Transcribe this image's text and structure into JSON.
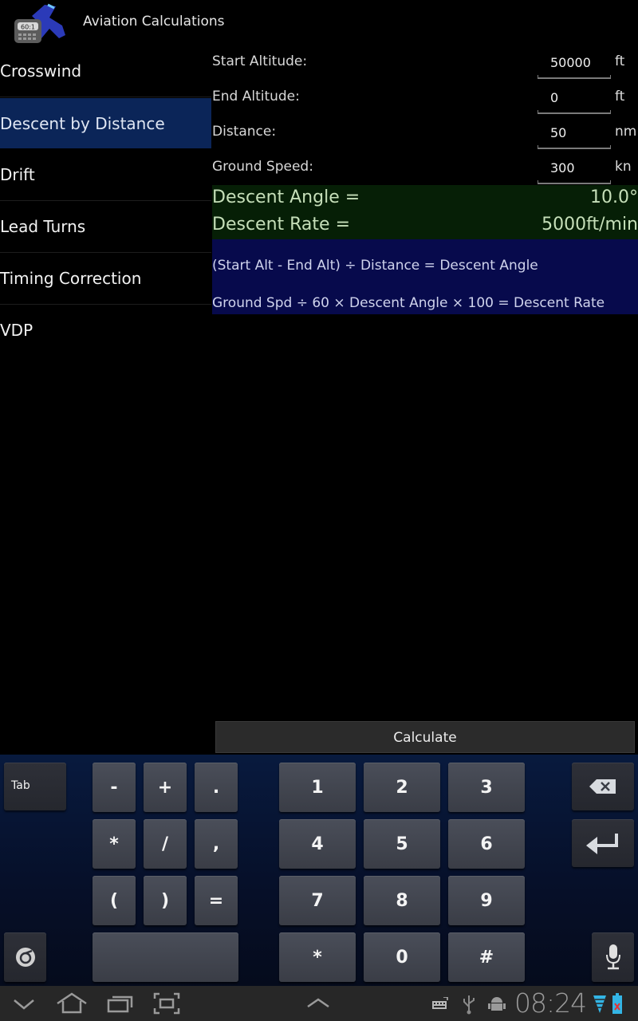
{
  "app": {
    "title": "Aviation Calculations",
    "icon": "app-icon-airplane-calculator",
    "icon_badge": "60:1"
  },
  "sidebar": {
    "items": [
      {
        "label": "Crosswind",
        "selected": false
      },
      {
        "label": "Descent by Distance",
        "selected": true
      },
      {
        "label": "Drift",
        "selected": false
      },
      {
        "label": "Lead Turns",
        "selected": false
      },
      {
        "label": "Timing Correction",
        "selected": false
      },
      {
        "label": "VDP",
        "selected": false
      }
    ]
  },
  "form": {
    "fields": [
      {
        "label": "Start Altitude:",
        "value": "50000",
        "unit": "ft"
      },
      {
        "label": "End Altitude:",
        "value": "0",
        "unit": "ft"
      },
      {
        "label": "Distance:",
        "value": "50",
        "unit": "nm"
      },
      {
        "label": "Ground Speed:",
        "value": "300",
        "unit": "kn"
      }
    ]
  },
  "results": {
    "descent_angle_label": "Descent Angle =",
    "descent_angle_value": "10.0°",
    "descent_rate_label": "Descent Rate =",
    "descent_rate_value": "5000ft/min"
  },
  "formulas": {
    "angle": "(Start Alt - End Alt) ÷ Distance = Descent Angle",
    "rate": "Ground Spd ÷ 60 × Descent Angle × 100 = Descent Rate"
  },
  "calculate_label": "Calculate",
  "keyboard": {
    "tab_label": "Tab",
    "symbols": [
      "-",
      "+",
      ".",
      "*",
      "/",
      ",",
      "(",
      ")",
      "="
    ],
    "digits": [
      "1",
      "2",
      "3",
      "4",
      "5",
      "6",
      "7",
      "8",
      "9",
      "*",
      "0",
      "#"
    ],
    "icons": {
      "backspace": "backspace-icon",
      "enter": "enter-icon",
      "settings": "keyboard-settings-icon",
      "mic": "microphone-icon"
    }
  },
  "navbar": {
    "buttons": [
      "back-icon",
      "home-icon",
      "recent-apps-icon",
      "screenshot-icon",
      "menu-up-icon"
    ],
    "status_icons": [
      "keyboard-icon",
      "usb-icon",
      "android-debug-icon",
      "wifi-icon",
      "battery-icon"
    ],
    "clock": "08:24"
  },
  "colors": {
    "selected_item_bg": "#0b2558",
    "results_bg": "#061f06",
    "results_text": "#c6dfb9",
    "formula_bg": "#070a4c",
    "wifi": "#33b5e5"
  }
}
